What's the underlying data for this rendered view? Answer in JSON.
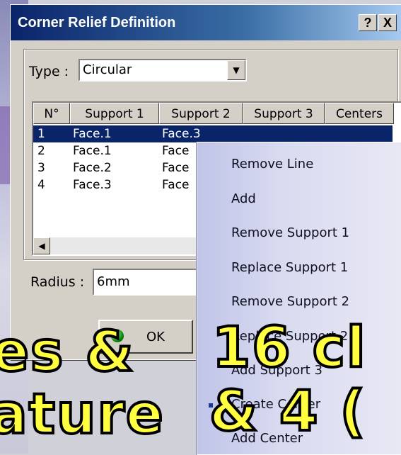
{
  "window": {
    "title": "Corner Relief Definition",
    "help_label": "?",
    "close_label": "X"
  },
  "type_field": {
    "label": "Type :",
    "value": "Circular"
  },
  "table": {
    "headers": [
      "N°",
      "Support 1",
      "Support 2",
      "Support 3",
      "Centers"
    ],
    "rows": [
      {
        "n": "1",
        "s1": "Face.1",
        "s2": "Face.3"
      },
      {
        "n": "2",
        "s1": "Face.1",
        "s2": "Face"
      },
      {
        "n": "3",
        "s1": "Face.2",
        "s2": "Face"
      },
      {
        "n": "4",
        "s1": "Face.3",
        "s2": "Face"
      }
    ],
    "selected_row": 1
  },
  "radius_field": {
    "label": "Radius :",
    "value": "6mm"
  },
  "ok_label": "OK",
  "context_menu": {
    "items": [
      "Remove Line",
      "Add",
      "Remove Support 1",
      "Replace Support 1",
      "Remove Support 2",
      "Replace Support 2",
      "Add Support 3",
      "Create Center",
      "Add Center"
    ],
    "checked_item": "Create Center"
  },
  "overlay_text": {
    "line1_left": "es &",
    "line1_right": "16 cl",
    "line2_left": "ature",
    "line2_right": "& 4 ("
  },
  "colors": {
    "selection": "#0a246a",
    "overlay_fill": "#ffff40",
    "menu_bg": "#d8daf0"
  }
}
